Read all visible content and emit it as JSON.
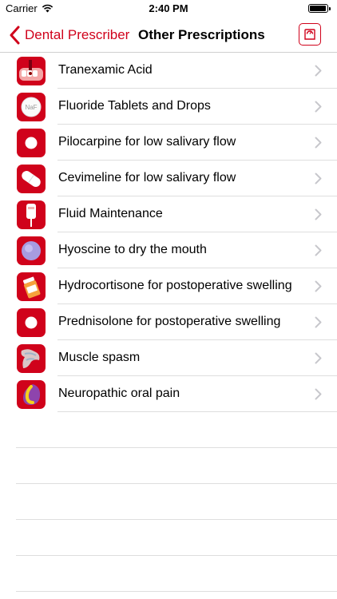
{
  "status_bar": {
    "carrier": "Carrier",
    "time": "2:40 PM",
    "wifi_icon": "wifi-icon",
    "battery_icon": "battery-icon"
  },
  "nav": {
    "back_label": "Dental Prescriber",
    "title": "Other Prescriptions",
    "action_icon": "weighing-scale-icon",
    "accent_color": "#d0021b"
  },
  "items": [
    {
      "label": "Tranexamic Acid",
      "icon": "bleeding-gum-icon"
    },
    {
      "label": "Fluoride Tablets and Drops",
      "icon": "fluoride-tablet-icon",
      "icon_text": "NaF"
    },
    {
      "label": "Pilocarpine for low salivary flow",
      "icon": "white-pill-icon"
    },
    {
      "label": "Cevimeline for low salivary flow",
      "icon": "capsule-icon"
    },
    {
      "label": "Fluid Maintenance",
      "icon": "iv-bag-icon"
    },
    {
      "label": "Hyoscine to dry the mouth",
      "icon": "purple-pill-icon"
    },
    {
      "label": "Hydrocortisone for postoperative swelling",
      "icon": "pill-bottle-icon"
    },
    {
      "label": "Prednisolone for postoperative swelling",
      "icon": "white-pill-icon"
    },
    {
      "label": "Muscle spasm",
      "icon": "muscle-icon"
    },
    {
      "label": "Neuropathic oral pain",
      "icon": "nerve-pain-icon"
    }
  ]
}
